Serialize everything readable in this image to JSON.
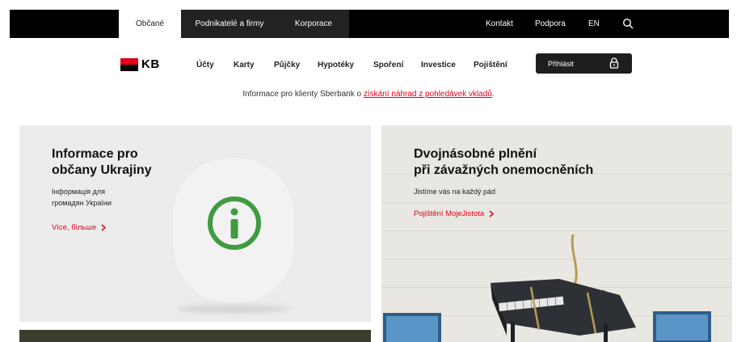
{
  "topbar": {
    "segments": [
      {
        "label": "Občané"
      },
      {
        "label": "Podnikatelé a firmy"
      },
      {
        "label": "Korporace"
      }
    ],
    "links": [
      {
        "label": "Kontakt"
      },
      {
        "label": "Podpora"
      },
      {
        "label": "EN"
      }
    ],
    "search_icon": "search-icon"
  },
  "mainnav": {
    "logo_text": "KB",
    "items": [
      {
        "label": "Účty"
      },
      {
        "label": "Karty"
      },
      {
        "label": "Půjčky"
      },
      {
        "label": "Hypotéky"
      },
      {
        "label": "Spoření"
      },
      {
        "label": "Investice"
      },
      {
        "label": "Pojištění"
      }
    ],
    "login_label": "Přihlásit",
    "login_icon": "lock-icon"
  },
  "info": {
    "prefix": "Informace pro klienty Sberbank o ",
    "link": "získání náhrad z pohledávek vkladů",
    "suffix": "."
  },
  "cards": {
    "left": {
      "title_line1": "Informace pro",
      "title_line2": "občany Ukrajiny",
      "sub_line1": "Інформація для",
      "sub_line2": "громадян України",
      "link": "Více, більше",
      "icon": "info-icon"
    },
    "right": {
      "title_line1": "Dvojnásobné plnění",
      "title_line2": "při závažných onemocněních",
      "sub": "Jistíme vás na každý pád",
      "link": "Pojištění MojeJistota",
      "icon": "piano-illustration"
    }
  },
  "colors": {
    "accent": "#e2001a",
    "dark": "#1e1e1e",
    "info_green": "#3f9b3f"
  }
}
